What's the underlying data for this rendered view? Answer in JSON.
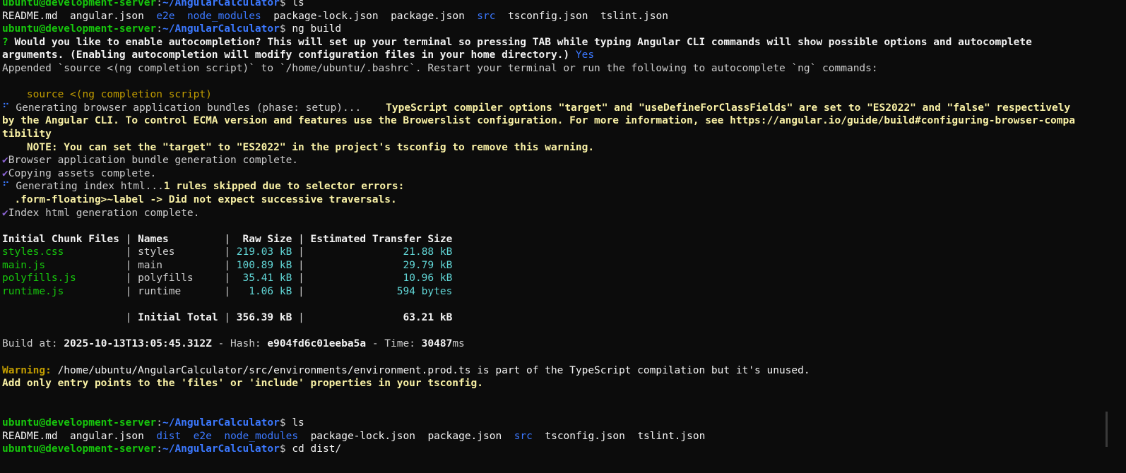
{
  "prompt": {
    "user_host": "ubuntu@development-server",
    "path": "~/AngularCalculator",
    "symbol": "$"
  },
  "cmd1": "ls",
  "ls1": {
    "f1": "README.md",
    "f2": "angular.json",
    "d1": "e2e",
    "d2": "node_modules",
    "f3": "package-lock.json",
    "f4": "package.json",
    "d3": "src",
    "f5": "tsconfig.json",
    "f6": "tslint.json"
  },
  "cmd2": "ng build",
  "autocomplete": {
    "mark": "?",
    "question_1": " Would you like to enable autocompletion? This will set up your terminal so pressing TAB while typing Angular CLI commands will show possible options and autocomplete",
    "question_2": "arguments. (Enabling autocompletion will modify configuration files in your home directory.)",
    "answer": "Yes",
    "appended": "Appended `source <(ng completion script)` to `/home/ubuntu/.bashrc`. Restart your terminal or run the following to autocomplete `ng` commands:",
    "source_cmd": "source <(ng completion script)"
  },
  "build": {
    "spinner": "⠋",
    "generating_bundles": " Generating browser application bundles (phase: setup)...",
    "ts_warning_1": "TypeScript compiler options \"target\" and \"useDefineForClassFields\" are set to \"ES2022\" and \"false\" respectively",
    "ts_warning_2": "by the Angular CLI. To control ECMA version and features use the Browerslist configuration. For more information, see https://angular.io/guide/build#configuring-browser-compa",
    "ts_warning_3": "tibility",
    "note": "NOTE: You can set the \"target\" to \"ES2022\" in the project's tsconfig to remove this warning.",
    "check": "✔",
    "bundle_complete": "Browser application bundle generation complete.",
    "assets_complete": "Copying assets complete.",
    "index_generating": " Generating index html...",
    "rules_skipped": "1 rules skipped due to selector errors:",
    "selector_error": ".form-floating>~label -> Did not expect successive traversals.",
    "index_complete": "Index html generation complete."
  },
  "chunk_table": {
    "headers": [
      "Initial Chunk Files",
      "Names",
      "Raw Size",
      "Estimated Transfer Size"
    ],
    "rows": [
      [
        "styles.css",
        "styles",
        "219.03 kB",
        "21.88 kB"
      ],
      [
        "main.js",
        "main",
        "100.89 kB",
        "29.79 kB"
      ],
      [
        "polyfills.js",
        "polyfills",
        "35.41 kB",
        "10.96 kB"
      ],
      [
        "runtime.js",
        "runtime",
        "1.06 kB",
        "594 bytes"
      ]
    ],
    "total_label": "Initial Total",
    "total_raw": "356.39 kB",
    "total_transfer": "63.21 kB"
  },
  "build_info": {
    "at_label": "Build at: ",
    "at": "2025-10-13T13:05:45.312Z",
    "hash_label": " - Hash: ",
    "hash": "e904fd6c01eeba5a",
    "time_label": " - Time: ",
    "time": "30487",
    "time_unit": "ms"
  },
  "warning": {
    "label": "Warning:",
    "text": " /home/ubuntu/AngularCalculator/src/environments/environment.prod.ts is part of the TypeScript compilation but it's unused.",
    "text2": "Add only entry points to the 'files' or 'include' properties in your tsconfig."
  },
  "cmd3": "ls",
  "ls2": {
    "f1": "README.md",
    "f2": "angular.json",
    "d1": "dist",
    "d2": "e2e",
    "d3": "node_modules",
    "f3": "package-lock.json",
    "f4": "package.json",
    "d4": "src",
    "f5": "tsconfig.json",
    "f6": "tslint.json"
  },
  "cmd4": "cd dist/",
  "colors": {
    "background": "#0c0c0c",
    "foreground": "#cccccc",
    "prompt_user": "#16c60c",
    "prompt_path": "#3b78ff",
    "directory": "#3b78ff",
    "warning": "#f9f1a5",
    "source": "#c19c00",
    "size": "#61d6d6",
    "check": "#8a63d2"
  }
}
